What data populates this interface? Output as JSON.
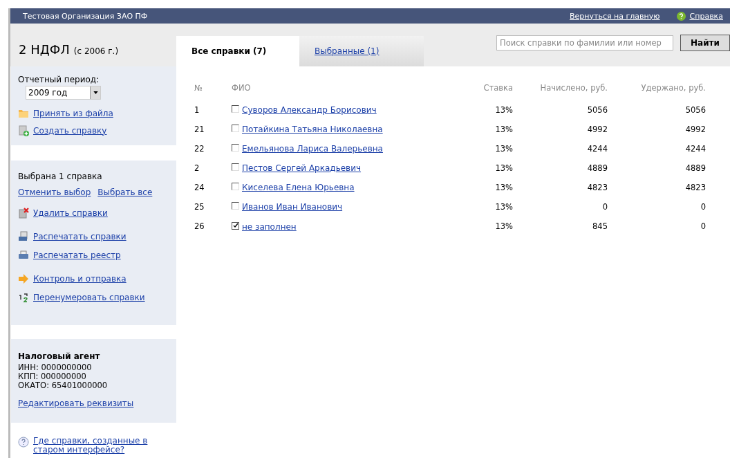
{
  "header": {
    "organization": "Тестовая Организация ЗАО ПФ",
    "home_link": "Вернуться на главную",
    "help_link": "Справка"
  },
  "title": {
    "main": "2 НДФЛ",
    "note": "(с 2006 г.)"
  },
  "tabs": [
    {
      "label": "Все справки (7)",
      "selected": true
    },
    {
      "label": "Выбранные (1)",
      "selected": false
    }
  ],
  "search": {
    "placeholder": "Поиск справки по фамилии или номер",
    "button": "Найти"
  },
  "period": {
    "label": "Отчетный период:",
    "value": "2009 год"
  },
  "actions_top": [
    {
      "kind": "folder",
      "label": "Принять из файла"
    },
    {
      "kind": "create",
      "label": "Создать справку"
    }
  ],
  "selection": {
    "status": "Выбрана 1 справка",
    "clear": "Отменить выбор",
    "select_all": "Выбрать все"
  },
  "actions": [
    {
      "kind": "delete",
      "label": "Удалить справки"
    },
    {
      "kind": "print-doc",
      "label": "Распечатать справки"
    },
    {
      "kind": "printer",
      "label": "Распечатать реестр"
    },
    {
      "kind": "arrow",
      "label": "Контроль и отправка"
    },
    {
      "kind": "renumber",
      "label": "Перенумеровать справки"
    }
  ],
  "agent": {
    "title": "Налоговый агент",
    "lines": [
      "ИНН: 0000000000",
      "КПП: 000000000",
      "ОКАТО: 65401000000"
    ],
    "edit": "Редактировать реквизиты"
  },
  "help_question": "Где справки, созданные в старом интерфейсе?",
  "table": {
    "columns": [
      "№",
      "ФИО",
      "Ставка",
      "Начислено, руб.",
      "Удержано, руб."
    ],
    "rows": [
      {
        "num": "1",
        "name": "Суворов Александр Борисович",
        "rate": "13%",
        "accrued": "5056",
        "withheld": "5056",
        "checked": false
      },
      {
        "num": "21",
        "name": "Потайкина Татьяна Николаевна",
        "rate": "13%",
        "accrued": "4992",
        "withheld": "4992",
        "checked": false
      },
      {
        "num": "22",
        "name": "Емельянова Лариса Валерьевна",
        "rate": "13%",
        "accrued": "4244",
        "withheld": "4244",
        "checked": false
      },
      {
        "num": "2",
        "name": "Пестов Сергей Аркадьевич",
        "rate": "13%",
        "accrued": "4889",
        "withheld": "4889",
        "checked": false
      },
      {
        "num": "24",
        "name": "Киселева Елена Юрьевна",
        "rate": "13%",
        "accrued": "4823",
        "withheld": "4823",
        "checked": false
      },
      {
        "num": "25",
        "name": "Иванов Иван Иванович",
        "rate": "13%",
        "accrued": "0",
        "withheld": "0",
        "checked": false
      },
      {
        "num": "26",
        "name": "не заполнен",
        "rate": "13%",
        "accrued": "845",
        "withheld": "0",
        "checked": true
      }
    ]
  }
}
